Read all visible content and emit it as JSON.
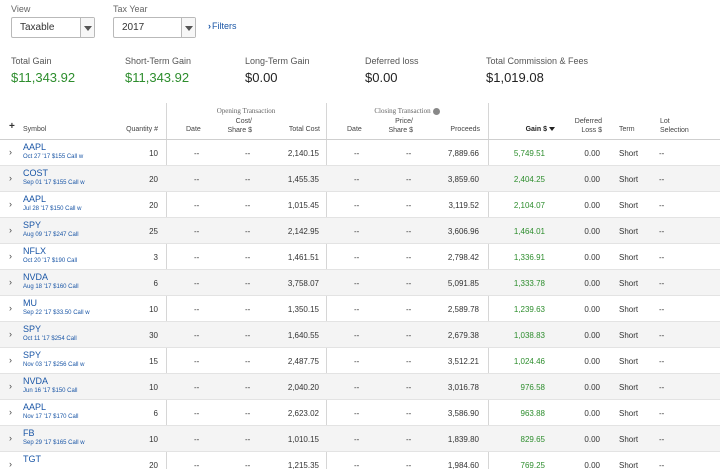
{
  "filters_bar": {
    "view_label": "View",
    "view_value": "Taxable",
    "tax_year_label": "Tax Year",
    "tax_year_value": "2017",
    "filters_link": "Filters"
  },
  "summary": [
    {
      "title": "Total Gain",
      "value": "$11,343.92",
      "highlight": true
    },
    {
      "title": "Short-Term Gain",
      "value": "$11,343.92",
      "highlight": true
    },
    {
      "title": "Long-Term Gain",
      "value": "$0.00",
      "highlight": false
    },
    {
      "title": "Deferred loss",
      "value": "$0.00",
      "highlight": false
    },
    {
      "title": "Total Commission & Fees",
      "value": "$1,019.08",
      "highlight": false
    }
  ],
  "table": {
    "group_opening": "Opening Transaction",
    "group_closing": "Closing Transaction",
    "columns": {
      "symbol": "Symbol",
      "quantity": "Quantity #",
      "open_date": "Date",
      "cost_share_1": "Cost/",
      "cost_share_2": "Share $",
      "total_cost": "Total Cost",
      "close_date": "Date",
      "price_share_1": "Price/",
      "price_share_2": "Share $",
      "proceeds": "Proceeds",
      "gain": "Gain $",
      "deferred_1": "Deferred",
      "deferred_2": "Loss $",
      "term": "Term",
      "lot_1": "Lot",
      "lot_2": "Selection"
    },
    "rows": [
      {
        "symbol": "AAPL",
        "desc": "Oct 27 '17 $155 Call w",
        "qty": "10",
        "open_date": "--",
        "cost_share": "--",
        "total_cost": "2,140.15",
        "close_date": "--",
        "price_share": "--",
        "proceeds": "7,889.66",
        "gain": "5,749.51",
        "deferred": "0.00",
        "term": "Short",
        "lot": "--"
      },
      {
        "symbol": "COST",
        "desc": "Sep 01 '17 $155 Call w",
        "qty": "20",
        "open_date": "--",
        "cost_share": "--",
        "total_cost": "1,455.35",
        "close_date": "--",
        "price_share": "--",
        "proceeds": "3,859.60",
        "gain": "2,404.25",
        "deferred": "0.00",
        "term": "Short",
        "lot": "--"
      },
      {
        "symbol": "AAPL",
        "desc": "Jul 28 '17 $150 Call w",
        "qty": "20",
        "open_date": "--",
        "cost_share": "--",
        "total_cost": "1,015.45",
        "close_date": "--",
        "price_share": "--",
        "proceeds": "3,119.52",
        "gain": "2,104.07",
        "deferred": "0.00",
        "term": "Short",
        "lot": "--"
      },
      {
        "symbol": "SPY",
        "desc": "Aug 09 '17 $247 Call",
        "qty": "25",
        "open_date": "--",
        "cost_share": "--",
        "total_cost": "2,142.95",
        "close_date": "--",
        "price_share": "--",
        "proceeds": "3,606.96",
        "gain": "1,464.01",
        "deferred": "0.00",
        "term": "Short",
        "lot": "--"
      },
      {
        "symbol": "NFLX",
        "desc": "Oct 20 '17 $190 Call",
        "qty": "3",
        "open_date": "--",
        "cost_share": "--",
        "total_cost": "1,461.51",
        "close_date": "--",
        "price_share": "--",
        "proceeds": "2,798.42",
        "gain": "1,336.91",
        "deferred": "0.00",
        "term": "Short",
        "lot": "--"
      },
      {
        "symbol": "NVDA",
        "desc": "Aug 18 '17 $160 Call",
        "qty": "6",
        "open_date": "--",
        "cost_share": "--",
        "total_cost": "3,758.07",
        "close_date": "--",
        "price_share": "--",
        "proceeds": "5,091.85",
        "gain": "1,333.78",
        "deferred": "0.00",
        "term": "Short",
        "lot": "--"
      },
      {
        "symbol": "MU",
        "desc": "Sep 22 '17 $33.50 Call w",
        "qty": "10",
        "open_date": "--",
        "cost_share": "--",
        "total_cost": "1,350.15",
        "close_date": "--",
        "price_share": "--",
        "proceeds": "2,589.78",
        "gain": "1,239.63",
        "deferred": "0.00",
        "term": "Short",
        "lot": "--"
      },
      {
        "symbol": "SPY",
        "desc": "Oct 11 '17 $254 Call",
        "qty": "30",
        "open_date": "--",
        "cost_share": "--",
        "total_cost": "1,640.55",
        "close_date": "--",
        "price_share": "--",
        "proceeds": "2,679.38",
        "gain": "1,038.83",
        "deferred": "0.00",
        "term": "Short",
        "lot": "--"
      },
      {
        "symbol": "SPY",
        "desc": "Nov 03 '17 $256 Call w",
        "qty": "15",
        "open_date": "--",
        "cost_share": "--",
        "total_cost": "2,487.75",
        "close_date": "--",
        "price_share": "--",
        "proceeds": "3,512.21",
        "gain": "1,024.46",
        "deferred": "0.00",
        "term": "Short",
        "lot": "--"
      },
      {
        "symbol": "NVDA",
        "desc": "Jun 16 '17 $150 Call",
        "qty": "10",
        "open_date": "--",
        "cost_share": "--",
        "total_cost": "2,040.20",
        "close_date": "--",
        "price_share": "--",
        "proceeds": "3,016.78",
        "gain": "976.58",
        "deferred": "0.00",
        "term": "Short",
        "lot": "--"
      },
      {
        "symbol": "AAPL",
        "desc": "Nov 17 '17 $170 Call",
        "qty": "6",
        "open_date": "--",
        "cost_share": "--",
        "total_cost": "2,623.02",
        "close_date": "--",
        "price_share": "--",
        "proceeds": "3,586.90",
        "gain": "963.88",
        "deferred": "0.00",
        "term": "Short",
        "lot": "--"
      },
      {
        "symbol": "FB",
        "desc": "Sep 29 '17 $165 Call w",
        "qty": "10",
        "open_date": "--",
        "cost_share": "--",
        "total_cost": "1,010.15",
        "close_date": "--",
        "price_share": "--",
        "proceeds": "1,839.80",
        "gain": "829.65",
        "deferred": "0.00",
        "term": "Short",
        "lot": "--"
      },
      {
        "symbol": "TGT",
        "desc": "",
        "qty": "20",
        "open_date": "--",
        "cost_share": "--",
        "total_cost": "1,215.35",
        "close_date": "--",
        "price_share": "--",
        "proceeds": "1,984.60",
        "gain": "769.25",
        "deferred": "0.00",
        "term": "Short",
        "lot": "--"
      }
    ]
  },
  "colors": {
    "gain_green": "#2d8d2d",
    "link_blue": "#1a56a6",
    "row_alt": "#f4f4f4"
  }
}
